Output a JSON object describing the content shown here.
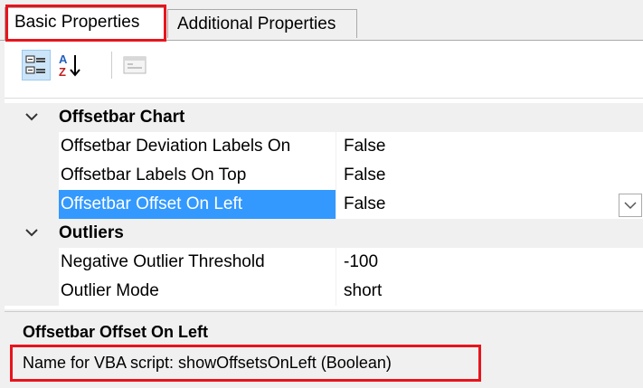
{
  "tabs": [
    {
      "label": "Basic Properties",
      "active": true
    },
    {
      "label": "Additional Properties",
      "active": false
    }
  ],
  "toolbar": {
    "categorized_icon": "categorized-icon",
    "alphabetical_icon": "sort-alphabetical-icon",
    "property_pages_icon": "property-pages-icon"
  },
  "categories": [
    {
      "label": "Offsetbar Chart",
      "properties": [
        {
          "name": "Offsetbar Deviation Labels On",
          "value": "False"
        },
        {
          "name": "Offsetbar Labels On Top",
          "value": "False"
        },
        {
          "name": "Offsetbar Offset On Left",
          "value": "False",
          "selected": true
        }
      ]
    },
    {
      "label": "Outliers",
      "properties": [
        {
          "name": "Negative Outlier Threshold",
          "value": "-100"
        },
        {
          "name": "Outlier Mode",
          "value": "short"
        }
      ]
    }
  ],
  "description": {
    "title": "Offsetbar Offset On Left",
    "text": "Name for VBA script: showOffsetsOnLeft (Boolean)"
  },
  "colors": {
    "selection": "#3399ff",
    "highlight_box": "#e8141c"
  }
}
